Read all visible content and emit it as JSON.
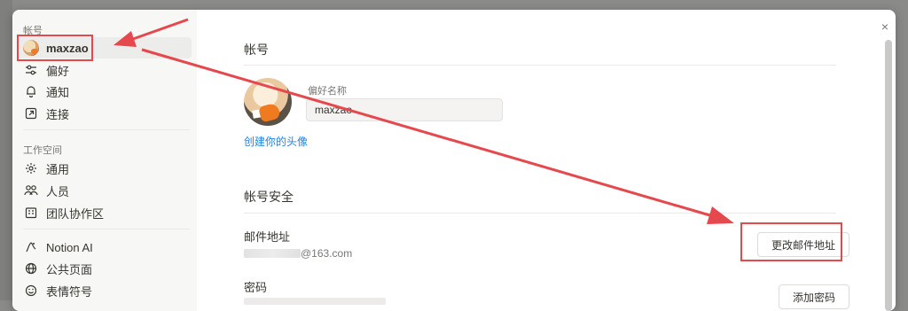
{
  "sidebar": {
    "account_section": "帐号",
    "account_items": [
      {
        "label": "maxzao",
        "icon": "user-avatar",
        "active": true
      },
      {
        "label": "偏好",
        "icon": "sliders-icon"
      },
      {
        "label": "通知",
        "icon": "bell-icon"
      },
      {
        "label": "连接",
        "icon": "external-link-icon"
      }
    ],
    "workspace_section": "工作空间",
    "workspace_items": [
      {
        "label": "通用",
        "icon": "gear-icon"
      },
      {
        "label": "人员",
        "icon": "people-icon"
      },
      {
        "label": "团队协作区",
        "icon": "building-icon"
      }
    ],
    "extra_items": [
      {
        "label": "Notion AI",
        "icon": "notion-ai-icon"
      },
      {
        "label": "公共页面",
        "icon": "globe-icon"
      },
      {
        "label": "表情符号",
        "icon": "smile-icon"
      }
    ]
  },
  "main": {
    "account_title": "帐号",
    "preferred_name_label": "偏好名称",
    "preferred_name_value": "maxzao",
    "create_avatar_link": "创建你的头像",
    "security_title": "帐号安全",
    "email_label": "邮件地址",
    "email_domain": "@163.com",
    "change_email_button": "更改邮件地址",
    "password_label": "密码",
    "add_password_button": "添加密码"
  },
  "close_symbol": "×",
  "colors": {
    "annotation_red": "#e5484d",
    "link_blue": "#2383e2",
    "sidebar_bg": "#f7f7f5"
  }
}
